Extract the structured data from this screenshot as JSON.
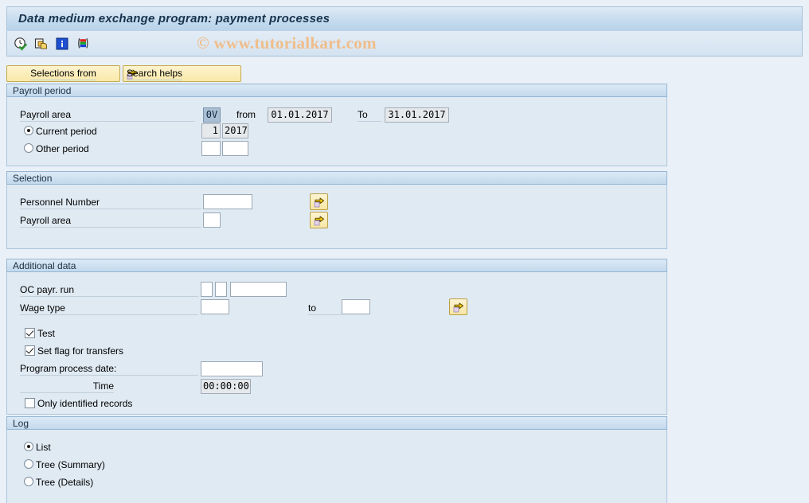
{
  "window": {
    "title": "Data medium exchange program: payment processes",
    "watermark": "© www.tutorialkart.com"
  },
  "toolbar": {
    "icons": [
      {
        "name": "execute-clock-icon",
        "title": "Execute with variant"
      },
      {
        "name": "copy-variant-icon",
        "title": "Get variant"
      },
      {
        "name": "info-icon",
        "title": "Program documentation"
      },
      {
        "name": "color-bars-icon",
        "title": "Display legend"
      }
    ]
  },
  "buttons": {
    "selections_from": "Selections from",
    "search_helps": "Search helps"
  },
  "payroll_period": {
    "title": "Payroll period",
    "payroll_area_label": "Payroll area",
    "payroll_area_value": "0V",
    "from_label": "from",
    "from_value": "01.01.2017",
    "to_label": "To",
    "to_value": "31.01.2017",
    "current_period_label": "Current period",
    "current_period_selected": true,
    "current_period_num": "1",
    "current_period_year": "2017",
    "other_period_label": "Other period",
    "other_period_selected": false,
    "other_period_num": "",
    "other_period_year": ""
  },
  "selection": {
    "title": "Selection",
    "personnel_number_label": "Personnel Number",
    "personnel_number_value": "",
    "payroll_area_label": "Payroll area",
    "payroll_area_value": "",
    "multi_select_icon": "multi-selection-arrow-icon"
  },
  "additional_data": {
    "title": "Additional data",
    "oc_payr_run_label": "OC payr. run",
    "oc_payr_run_v1": "",
    "oc_payr_run_v2": "",
    "oc_payr_run_v3": "",
    "wage_type_label": "Wage type",
    "wage_type_from": "",
    "wage_type_to_label": "to",
    "wage_type_to": "",
    "test_label": "Test",
    "test_checked": true,
    "set_flag_label": "Set flag for transfers",
    "set_flag_checked": true,
    "program_process_date_label": "Program process date:",
    "program_process_date_value": "",
    "time_label": "Time",
    "time_value": "00:00:00",
    "only_identified_label": "Only identified records",
    "only_identified_checked": false
  },
  "log": {
    "title": "Log",
    "options": [
      {
        "label": "List",
        "selected": true
      },
      {
        "label": "Tree (Summary)",
        "selected": false
      },
      {
        "label": "Tree (Details)",
        "selected": false
      }
    ]
  },
  "colors": {
    "page_bg": "#eaf0f7",
    "panel_body": "#e0eaf3",
    "panel_header": "#c3d9ec",
    "button_yellow": "#fae9a9",
    "title_text": "#19334d",
    "watermark": "#f0bd8a",
    "selected_field": "#a9bfd4"
  }
}
